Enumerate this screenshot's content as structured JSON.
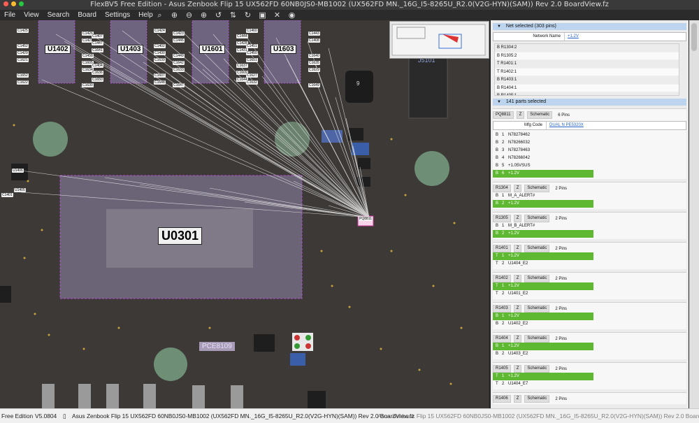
{
  "window": {
    "title": "FlexBV5 Free Edition - Asus Zenbook Flip 15 UX562FD 60NB0JS0-MB1002 (UX562FD MN._16G_I5-8265U_R2.0(V2G-HYN)(SAM)) Rev 2.0 BoardView.fz"
  },
  "menu": [
    "File",
    "View",
    "Search",
    "Board",
    "Settings",
    "Help"
  ],
  "toolbar": [
    "search-icon",
    "zoom-in-icon",
    "zoom-out-icon",
    "zoom-fit-icon",
    "rotate-ccw-icon",
    "flip-icon",
    "rotate-cw-icon",
    "fit-selection-icon",
    "close-icon",
    "hide-icon"
  ],
  "board": {
    "components": {
      "u1402": "U1402",
      "u1403": "U1403",
      "u1601": "U1601",
      "u1603": "U1603",
      "u0301": "U0301",
      "j5101": "J5101",
      "pce8109": "PCE8109",
      "pq8811": "PQ8811",
      "u1406": "U1406",
      "u1405": "U1405",
      "c1401": "C1401",
      "nine": "9"
    },
    "caps": [
      "C1425",
      "C1426",
      "C1407",
      "C1424",
      "C1423",
      "C1444",
      "C1460",
      "C1443",
      "C1452",
      "C142",
      "C1447",
      "C1402",
      "C1446",
      "C1428",
      "C1451",
      "C1408",
      "C1429",
      "C1458",
      "C1641",
      "C1430",
      "C1449",
      "C1431",
      "C1450",
      "C1640",
      "C1621",
      "C1605",
      "C1404",
      "C1639",
      "C1642",
      "C1637",
      "C1651",
      "C1635",
      "C1652",
      "C1634",
      "C1636",
      "C1607",
      "C1633",
      "C1609",
      "C1627",
      "C1629",
      "C1622",
      "C1630",
      "C1650",
      "C1648",
      "C1647",
      "C1644",
      "C1632",
      "C1649"
    ]
  },
  "panel": {
    "net_header": "Net selected (303 pins)",
    "net_name_label": "Network Name",
    "net_name_value": "+1.2V",
    "net_pins": [
      "B R1304:2",
      "B R1305:2",
      "T R1401:1",
      "T R1402:1",
      "B R1403:1",
      "B R1404:1",
      "B R1405:1"
    ],
    "parts_header": "141 parts selected",
    "z_label": "Z",
    "schematic_label": "Schematic",
    "parts": [
      {
        "ref": "PQ8811",
        "pins_count": "6 Pins",
        "mfg_label": "Mfg Code",
        "mfg_value": "DUAL N PE5320X",
        "pins": [
          {
            "side": "B",
            "num": "1",
            "net": "N78278462",
            "hl": false
          },
          {
            "side": "B",
            "num": "2",
            "net": "N78266032",
            "hl": false
          },
          {
            "side": "B",
            "num": "3",
            "net": "N78278463",
            "hl": false
          },
          {
            "side": "B",
            "num": "4",
            "net": "N78266042",
            "hl": false
          },
          {
            "side": "B",
            "num": "5",
            "net": "+1.05VSUS",
            "hl": false
          },
          {
            "side": "B",
            "num": "6",
            "net": "+1.2V",
            "hl": true
          }
        ]
      },
      {
        "ref": "R1304",
        "pins_count": "2 Pins",
        "pins": [
          {
            "side": "B",
            "num": "1",
            "net": "M_A_ALERT#",
            "hl": false
          },
          {
            "side": "B",
            "num": "2",
            "net": "+1.2V",
            "hl": true
          }
        ]
      },
      {
        "ref": "R1305",
        "pins_count": "2 Pins",
        "pins": [
          {
            "side": "B",
            "num": "1",
            "net": "M_B_ALERT#",
            "hl": false
          },
          {
            "side": "B",
            "num": "2",
            "net": "+1.2V",
            "hl": true
          }
        ]
      },
      {
        "ref": "R1401",
        "pins_count": "2 Pins",
        "pins": [
          {
            "side": "T",
            "num": "1",
            "net": "+1.2V",
            "hl": true
          },
          {
            "side": "T",
            "num": "2",
            "net": "U1404_E2",
            "hl": false
          }
        ]
      },
      {
        "ref": "R1402",
        "pins_count": "2 Pins",
        "pins": [
          {
            "side": "T",
            "num": "1",
            "net": "+1.2V",
            "hl": true
          },
          {
            "side": "T",
            "num": "2",
            "net": "U1401_E2",
            "hl": false
          }
        ]
      },
      {
        "ref": "R1403",
        "pins_count": "2 Pins",
        "pins": [
          {
            "side": "B",
            "num": "1",
            "net": "+1.2V",
            "hl": true
          },
          {
            "side": "B",
            "num": "2",
            "net": "U1402_E2",
            "hl": false
          }
        ]
      },
      {
        "ref": "R1404",
        "pins_count": "2 Pins",
        "pins": [
          {
            "side": "B",
            "num": "1",
            "net": "+1.2V",
            "hl": true
          },
          {
            "side": "B",
            "num": "2",
            "net": "U1403_E2",
            "hl": false
          }
        ]
      },
      {
        "ref": "R1405",
        "pins_count": "2 Pins",
        "pins": [
          {
            "side": "T",
            "num": "1",
            "net": "+1.2V",
            "hl": true
          },
          {
            "side": "T",
            "num": "2",
            "net": "U1404_E7",
            "hl": false
          }
        ]
      },
      {
        "ref": "R1406",
        "pins_count": "2 Pins",
        "pins": []
      }
    ]
  },
  "status": {
    "edition": "Free Edition",
    "version": "V5.0804",
    "file": "Asus Zenbook Flip 15 UX562FD 60NB0JS0-MB1002 (UX562FD MN._16G_I5-8265U_R2.0(V2G-HYN)(SAM)) Rev 2.0 BoardView.fz",
    "overlap": "Asus Zenbook Flip 15 UX562FD 60NB0JS0-MB1002 (UX562FD MN._16G_I5-8265U_R2.0(V2G-HYN)(SAM)) Rev 2.0 BoardView.fz"
  },
  "colors": {
    "highlight_pin": "#5fb832",
    "section_header": "#bcd4ee",
    "board_bg": "#3c3937",
    "link": "#2a66c6"
  }
}
